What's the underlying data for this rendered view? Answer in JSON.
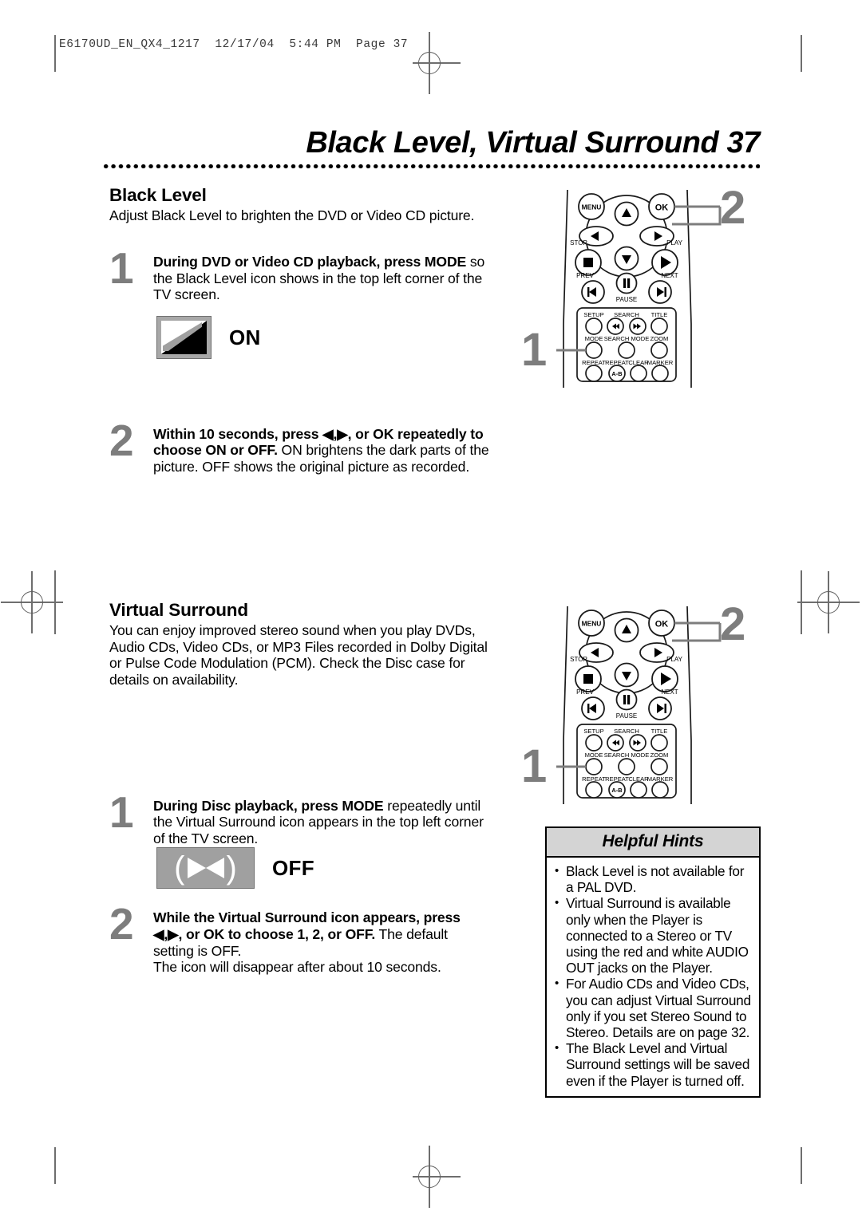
{
  "print_header": "E6170UD_EN_QX4_1217  12/17/04  5:44 PM  Page 37",
  "page_title": "Black Level, Virtual Surround  37",
  "sections": [
    {
      "heading": "Black Level",
      "intro": "Adjust Black Level to brighten the DVD or Video CD picture.",
      "steps": [
        {
          "number": "1",
          "bold_lead": "During DVD or Video CD playback, press MODE",
          "rest": " so the Black Level icon shows in the top left corner of the TV screen."
        },
        {
          "number": "2",
          "bold_lead": "Within 10 seconds, press ◀,▶, or OK repeatedly to choose ON or OFF.",
          "rest": " ON brightens the dark parts of the picture. OFF shows the original picture as recorded."
        }
      ],
      "icon": {
        "name": "black-level-on-icon",
        "label": "ON"
      }
    },
    {
      "heading": "Virtual Surround",
      "intro": "You can enjoy improved stereo sound when you play DVDs, Audio CDs, Video CDs, or MP3 Files recorded in Dolby Digital or Pulse Code Modulation (PCM). Check the Disc case for details on availability.",
      "steps": [
        {
          "number": "1",
          "bold_lead": "During Disc playback, press MODE",
          "rest": " repeatedly until the Virtual Surround icon appears in the top left corner of the TV screen."
        },
        {
          "number": "2",
          "bold_lead": "While the Virtual Surround icon appears, press ◀,▶, or OK to choose 1, 2, or OFF.",
          "rest": " The default setting is OFF.",
          "extra": "The icon will disappear after about 10 seconds."
        }
      ],
      "icon": {
        "name": "virtual-surround-off-icon",
        "label": "OFF"
      }
    }
  ],
  "remote": {
    "menu": "MENU",
    "ok": "OK",
    "stop": "STOP",
    "play": "PLAY",
    "prev": "PREV",
    "pause": "PAUSE",
    "next": "NEXT",
    "keypad": [
      [
        "SETUP",
        "SEARCH",
        "",
        "TITLE"
      ],
      [
        "MODE",
        "SEARCH MODE",
        "",
        "ZOOM"
      ],
      [
        "REPEAT",
        "REPEAT",
        "CLEAR",
        "MARKER"
      ]
    ],
    "repeat_ab": "A-B",
    "callout_step1": "1",
    "callout_step2": "2"
  },
  "hints": {
    "title": "Helpful Hints",
    "items": [
      "Black Level is not available for a PAL DVD.",
      "Virtual Surround is available only when the Player is connected to a Stereo or TV using the red and white AUDIO OUT jacks on the Player.",
      "For Audio CDs and Video CDs, you can adjust Virtual Surround only if you set Stereo Sound to Stereo. Details are on page 32.",
      "The Black Level and Virtual Surround settings will be saved even if the Player is turned off."
    ]
  },
  "colors": {
    "step_number_gray": "#7d7d7d",
    "hint_header_gray": "#d4d4d4",
    "icon_gray": "#a0a0a0",
    "rule_black": "#000000"
  }
}
